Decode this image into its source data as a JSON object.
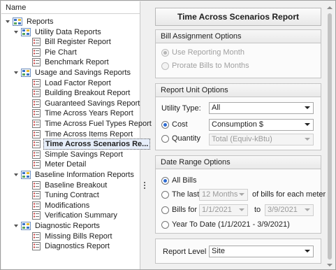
{
  "tree": {
    "header": "Name",
    "root": "Reports",
    "groups": [
      {
        "label": "Utility Data Reports",
        "items": [
          "Bill Register Report",
          "Pie Chart",
          "Benchmark Report"
        ]
      },
      {
        "label": "Usage and Savings Reports",
        "items": [
          "Load Factor Report",
          "Building Breakout Report",
          "Guaranteed Savings Report",
          "Time Across Years Report",
          "Time Across Fuel Types Report",
          "Time Across Items Report",
          "Time Across Scenarios Re...",
          "Simple Savings Report",
          "Meter Detail"
        ]
      },
      {
        "label": "Baseline Information Reports",
        "items": [
          "Baseline Breakout",
          "Tuning Contract",
          "Modifications",
          "Verification Summary"
        ]
      },
      {
        "label": "Diagnostic Reports",
        "items": [
          "Missing Bills Report",
          "Diagnostics Report"
        ]
      }
    ],
    "selected": "Time Across Scenarios Re..."
  },
  "report": {
    "title": "Time Across Scenarios Report",
    "bill_assignment": {
      "title": "Bill Assignment Options",
      "use_reporting_month": "Use Reporting Month",
      "prorate": "Prorate Bills to Months"
    },
    "unit_options": {
      "title": "Report Unit Options",
      "utility_type_label": "Utility Type:",
      "utility_type_value": "All",
      "cost_label": "Cost",
      "cost_value": "Consumption $",
      "quantity_label": "Quantity",
      "quantity_value": "Total (Equiv-kBtu)"
    },
    "date_range": {
      "title": "Date Range Options",
      "all_bills": "All Bills",
      "the_last": "The last",
      "the_last_value": "12 Months",
      "the_last_suffix": "of bills for each meter",
      "bills_for": "Bills for",
      "from_date": "1/1/2021",
      "to_label": "to",
      "to_date": "3/9/2021",
      "ytd": "Year To Date (1/1/2021 - 3/9/2021)"
    },
    "report_level": {
      "label": "Report Level",
      "value": "Site"
    }
  },
  "icons": {
    "caret": "caret-down-icon",
    "report_group": "report-group-icon",
    "report_item": "report-item-icon"
  },
  "colors": {
    "accent": "#2e6bd2",
    "selection_bg": "#e6eefa",
    "group_icon_blue": "#3a73c9",
    "group_icon_yellow": "#e7b92f",
    "item_icon_red": "#cc3b3b"
  }
}
